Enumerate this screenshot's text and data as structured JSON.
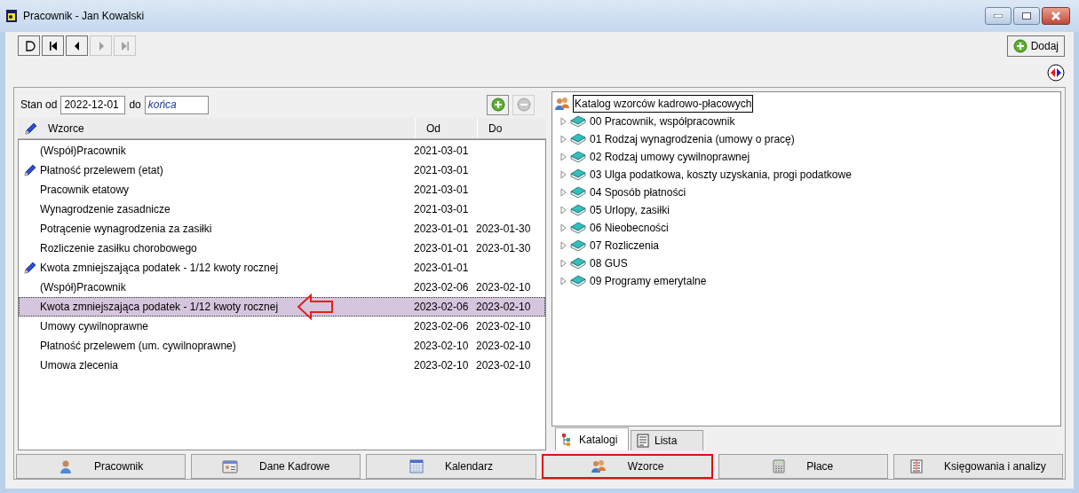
{
  "window": {
    "title": "Pracownik - Jan Kowalski"
  },
  "nav_buttons": [
    {
      "kind": "new",
      "disabled": false
    },
    {
      "kind": "first",
      "disabled": false
    },
    {
      "kind": "prev",
      "disabled": false
    },
    {
      "kind": "next",
      "disabled": true
    },
    {
      "kind": "last",
      "disabled": true
    }
  ],
  "add_button": {
    "label": "Dodaj"
  },
  "filter": {
    "from_label": "Stan od",
    "from_value": "2022-12-01",
    "to_label": "do",
    "to_value": "końca"
  },
  "row_buttons": [
    {
      "kind": "add",
      "disabled": false
    },
    {
      "kind": "remove",
      "disabled": true
    }
  ],
  "table": {
    "columns": [
      "Wzorce",
      "Od",
      "Do"
    ],
    "rows": [
      {
        "name": "(Współ)Pracownik",
        "from": "2021-03-01",
        "to": "",
        "edited": false,
        "selected": false
      },
      {
        "name": "Płatność przelewem (etat)",
        "from": "2021-03-01",
        "to": "",
        "edited": true,
        "selected": false
      },
      {
        "name": "Pracownik etatowy",
        "from": "2021-03-01",
        "to": "",
        "edited": false,
        "selected": false
      },
      {
        "name": "Wynagrodzenie zasadnicze",
        "from": "2021-03-01",
        "to": "",
        "edited": false,
        "selected": false
      },
      {
        "name": "Potrącenie wynagrodzenia za zasiłki",
        "from": "2023-01-01",
        "to": "2023-01-30",
        "edited": false,
        "selected": false
      },
      {
        "name": "Rozliczenie zasiłku chorobowego",
        "from": "2023-01-01",
        "to": "2023-01-30",
        "edited": false,
        "selected": false
      },
      {
        "name": "Kwota zmniejszająca podatek - 1/12 kwoty rocznej",
        "from": "2023-01-01",
        "to": "",
        "edited": true,
        "selected": false
      },
      {
        "name": "(Współ)Pracownik",
        "from": "2023-02-06",
        "to": "2023-02-10",
        "edited": false,
        "selected": false
      },
      {
        "name": "Kwota zmniejszająca podatek - 1/12 kwoty rocznej",
        "from": "2023-02-06",
        "to": "2023-02-10",
        "edited": false,
        "selected": true
      },
      {
        "name": "Umowy cywilnoprawne",
        "from": "2023-02-06",
        "to": "2023-02-10",
        "edited": false,
        "selected": false
      },
      {
        "name": "Płatność przelewem (um. cywilnoprawne)",
        "from": "2023-02-10",
        "to": "2023-02-10",
        "edited": false,
        "selected": false
      },
      {
        "name": "Umowa zlecenia",
        "from": "2023-02-10",
        "to": "2023-02-10",
        "edited": false,
        "selected": false
      }
    ]
  },
  "tree": {
    "root": {
      "label": "Katalog wzorców kadrowo-płacowych",
      "selected": true
    },
    "items": [
      {
        "label": "00 Pracownik, współpracownik",
        "expanded": false
      },
      {
        "label": "01 Rodzaj wynagrodzenia (umowy o pracę)",
        "expanded": false
      },
      {
        "label": "02 Rodzaj umowy cywilnoprawnej",
        "expanded": false
      },
      {
        "label": "03 Ulga podatkowa, koszty uzyskania, progi podatkowe",
        "expanded": false
      },
      {
        "label": "04 Sposób płatności",
        "expanded": false
      },
      {
        "label": "05 Urlopy, zasiłki",
        "expanded": false
      },
      {
        "label": "06 Nieobecności",
        "expanded": false
      },
      {
        "label": "07 Rozliczenia",
        "expanded": false
      },
      {
        "label": "08 GUS",
        "expanded": false
      },
      {
        "label": "09 Programy emerytalne",
        "expanded": false
      }
    ]
  },
  "tree_tabs": [
    {
      "label": "Katalogi",
      "kind": "tree",
      "selected": true
    },
    {
      "label": "Lista",
      "kind": "list",
      "selected": false
    }
  ],
  "bottom_tabs": [
    {
      "label": "Pracownik",
      "kind": "person",
      "selected": false
    },
    {
      "label": "Dane Kadrowe",
      "kind": "card",
      "selected": false
    },
    {
      "label": "Kalendarz",
      "kind": "calendar",
      "selected": false
    },
    {
      "label": "Wzorce",
      "kind": "people",
      "selected": true
    },
    {
      "label": "Płace",
      "kind": "calculator",
      "selected": false
    },
    {
      "label": "Księgowania i analizy",
      "kind": "ledger",
      "selected": false
    }
  ]
}
